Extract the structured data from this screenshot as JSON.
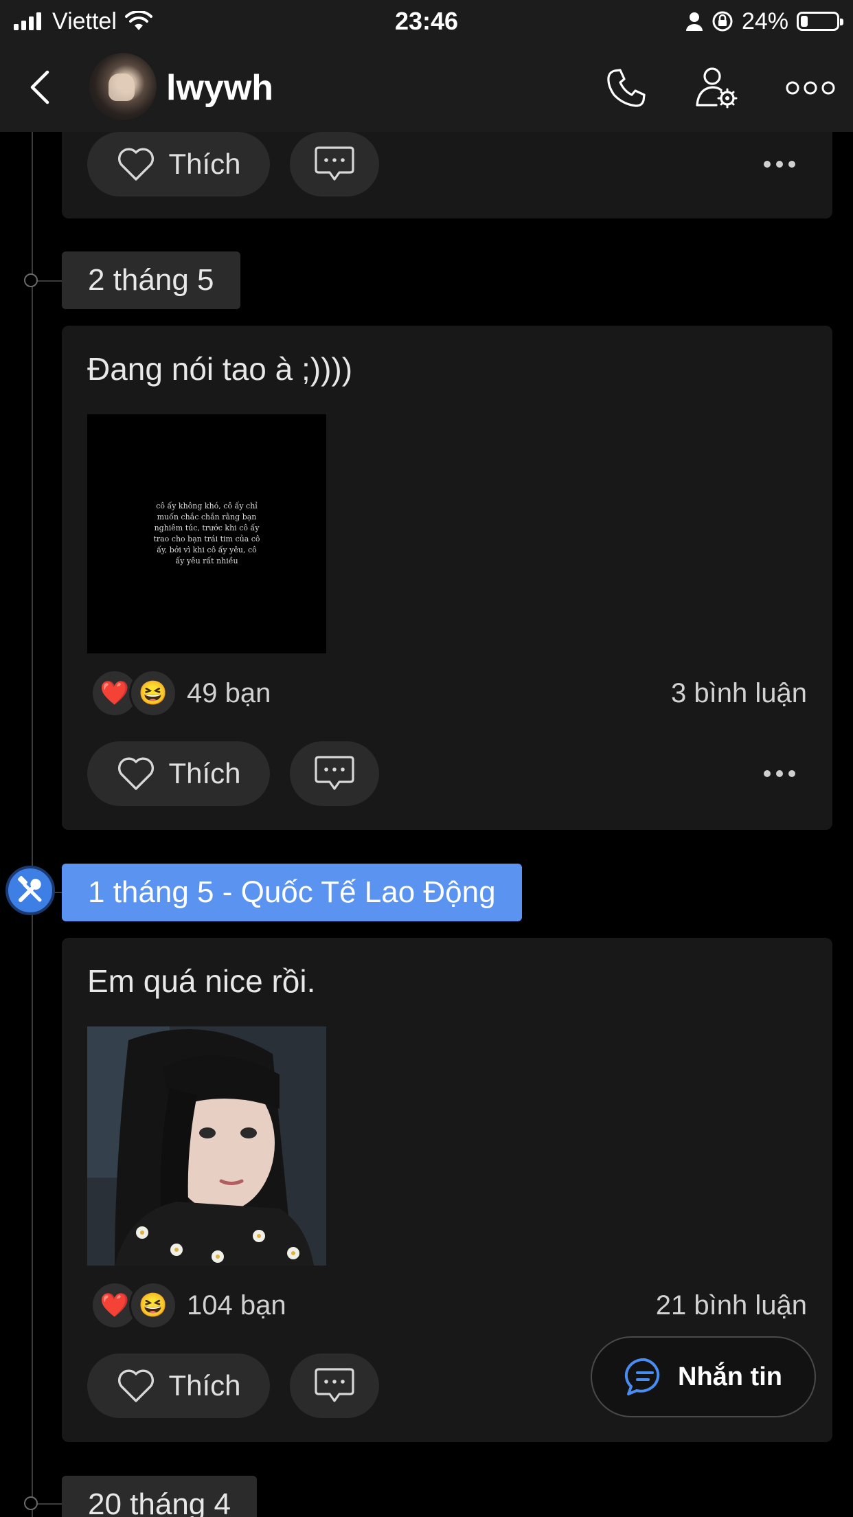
{
  "status_bar": {
    "carrier": "Viettel",
    "time": "23:46",
    "battery": "24%"
  },
  "header": {
    "username": "lwywh"
  },
  "actions": {
    "like_label": "Thích"
  },
  "dates": {
    "d1": "2 tháng 5",
    "d2": "1 tháng 5 - Quốc Tế Lao Động",
    "d3": "20 tháng 4"
  },
  "posts": [
    {
      "text": "Đang nói tao à ;))))",
      "image_caption": "cô ấy không khó, cô ấy chỉ muốn chắc chắn rằng bạn nghiêm túc, trước khi cô ấy trao cho bạn trái tim của cô ấy, bởi vì khi cô ấy yêu, cô ấy yêu rất nhiều",
      "reaction_count": "49 bạn",
      "comment_count": "3 bình luận"
    },
    {
      "text": "Em quá nice rồi.",
      "reaction_count": "104 bạn",
      "comment_count": "21 bình luận"
    }
  ],
  "message_button": {
    "label": "Nhắn tin"
  },
  "colors": {
    "accent": "#5b93f0",
    "background": "#000000",
    "card": "#181818"
  }
}
